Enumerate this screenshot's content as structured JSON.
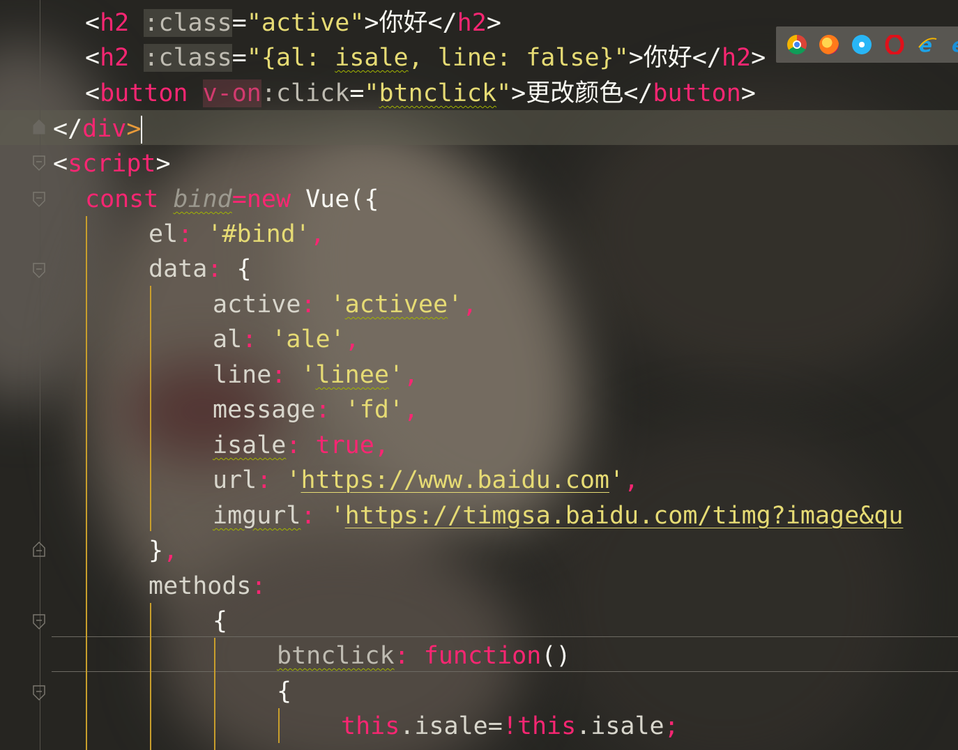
{
  "editor": {
    "lines": [
      {
        "tokens": [
          "<",
          "h2",
          " ",
          ":class",
          "=",
          "\"active\"",
          ">",
          "你好",
          "</",
          "h2",
          ">"
        ]
      },
      {
        "tokens": [
          "<",
          "h2",
          " ",
          ":class",
          "=",
          "\"{al: ",
          "isale",
          ", line: false}\"",
          ">",
          "你好",
          "</",
          "h2",
          ">"
        ]
      },
      {
        "tokens": [
          "<",
          "button",
          " ",
          "v-on",
          ":click",
          "=",
          "\"",
          "btnclick",
          "\"",
          ">",
          "更改颜色",
          "</",
          "button",
          ">"
        ]
      },
      {
        "tokens": [
          "</",
          "div",
          ">"
        ]
      },
      {
        "tokens": [
          "<",
          "script",
          ">"
        ]
      },
      {
        "tokens": [
          "const",
          " ",
          "bind",
          "=",
          "new",
          " Vue({"
        ]
      },
      {
        "tokens": [
          "el",
          ": ",
          "'#bind'",
          ","
        ]
      },
      {
        "tokens": [
          "data",
          ": ",
          "{"
        ]
      },
      {
        "tokens": [
          "active",
          ": ",
          "'",
          "activee",
          "'",
          ","
        ]
      },
      {
        "tokens": [
          "al",
          ": ",
          "'ale'",
          ","
        ]
      },
      {
        "tokens": [
          "line",
          ": ",
          "'",
          "linee",
          "'",
          ","
        ]
      },
      {
        "tokens": [
          "message",
          ": ",
          "'fd'",
          ","
        ]
      },
      {
        "tokens": [
          "isale",
          ": ",
          "true",
          ","
        ]
      },
      {
        "tokens": [
          "url",
          ": ",
          "'",
          "https://www.baidu.com",
          "'",
          ","
        ]
      },
      {
        "tokens": [
          "imgurl",
          ": ",
          "'",
          "https://timgsa.baidu.com/timg?image&qu"
        ]
      },
      {
        "tokens": [
          "}",
          ","
        ]
      },
      {
        "tokens": [
          "methods",
          ":"
        ]
      },
      {
        "tokens": [
          "{"
        ]
      },
      {
        "tokens": [
          "btnclick",
          ": ",
          "function",
          "()"
        ]
      },
      {
        "tokens": [
          "{"
        ]
      },
      {
        "tokens": [
          "this",
          ".isale=",
          "!",
          "this",
          ".isale",
          ";"
        ]
      }
    ]
  },
  "browser_icons": [
    {
      "name": "chrome-icon",
      "color": "#db4437"
    },
    {
      "name": "firefox-icon",
      "color": "#ff7a1a"
    },
    {
      "name": "safari-icon",
      "color": "#1e88e5"
    },
    {
      "name": "opera-icon",
      "color": "#e0101a"
    },
    {
      "name": "ie-icon",
      "color": "#1ea3e8"
    },
    {
      "name": "edge-icon",
      "color": "#1a8fd8"
    }
  ]
}
